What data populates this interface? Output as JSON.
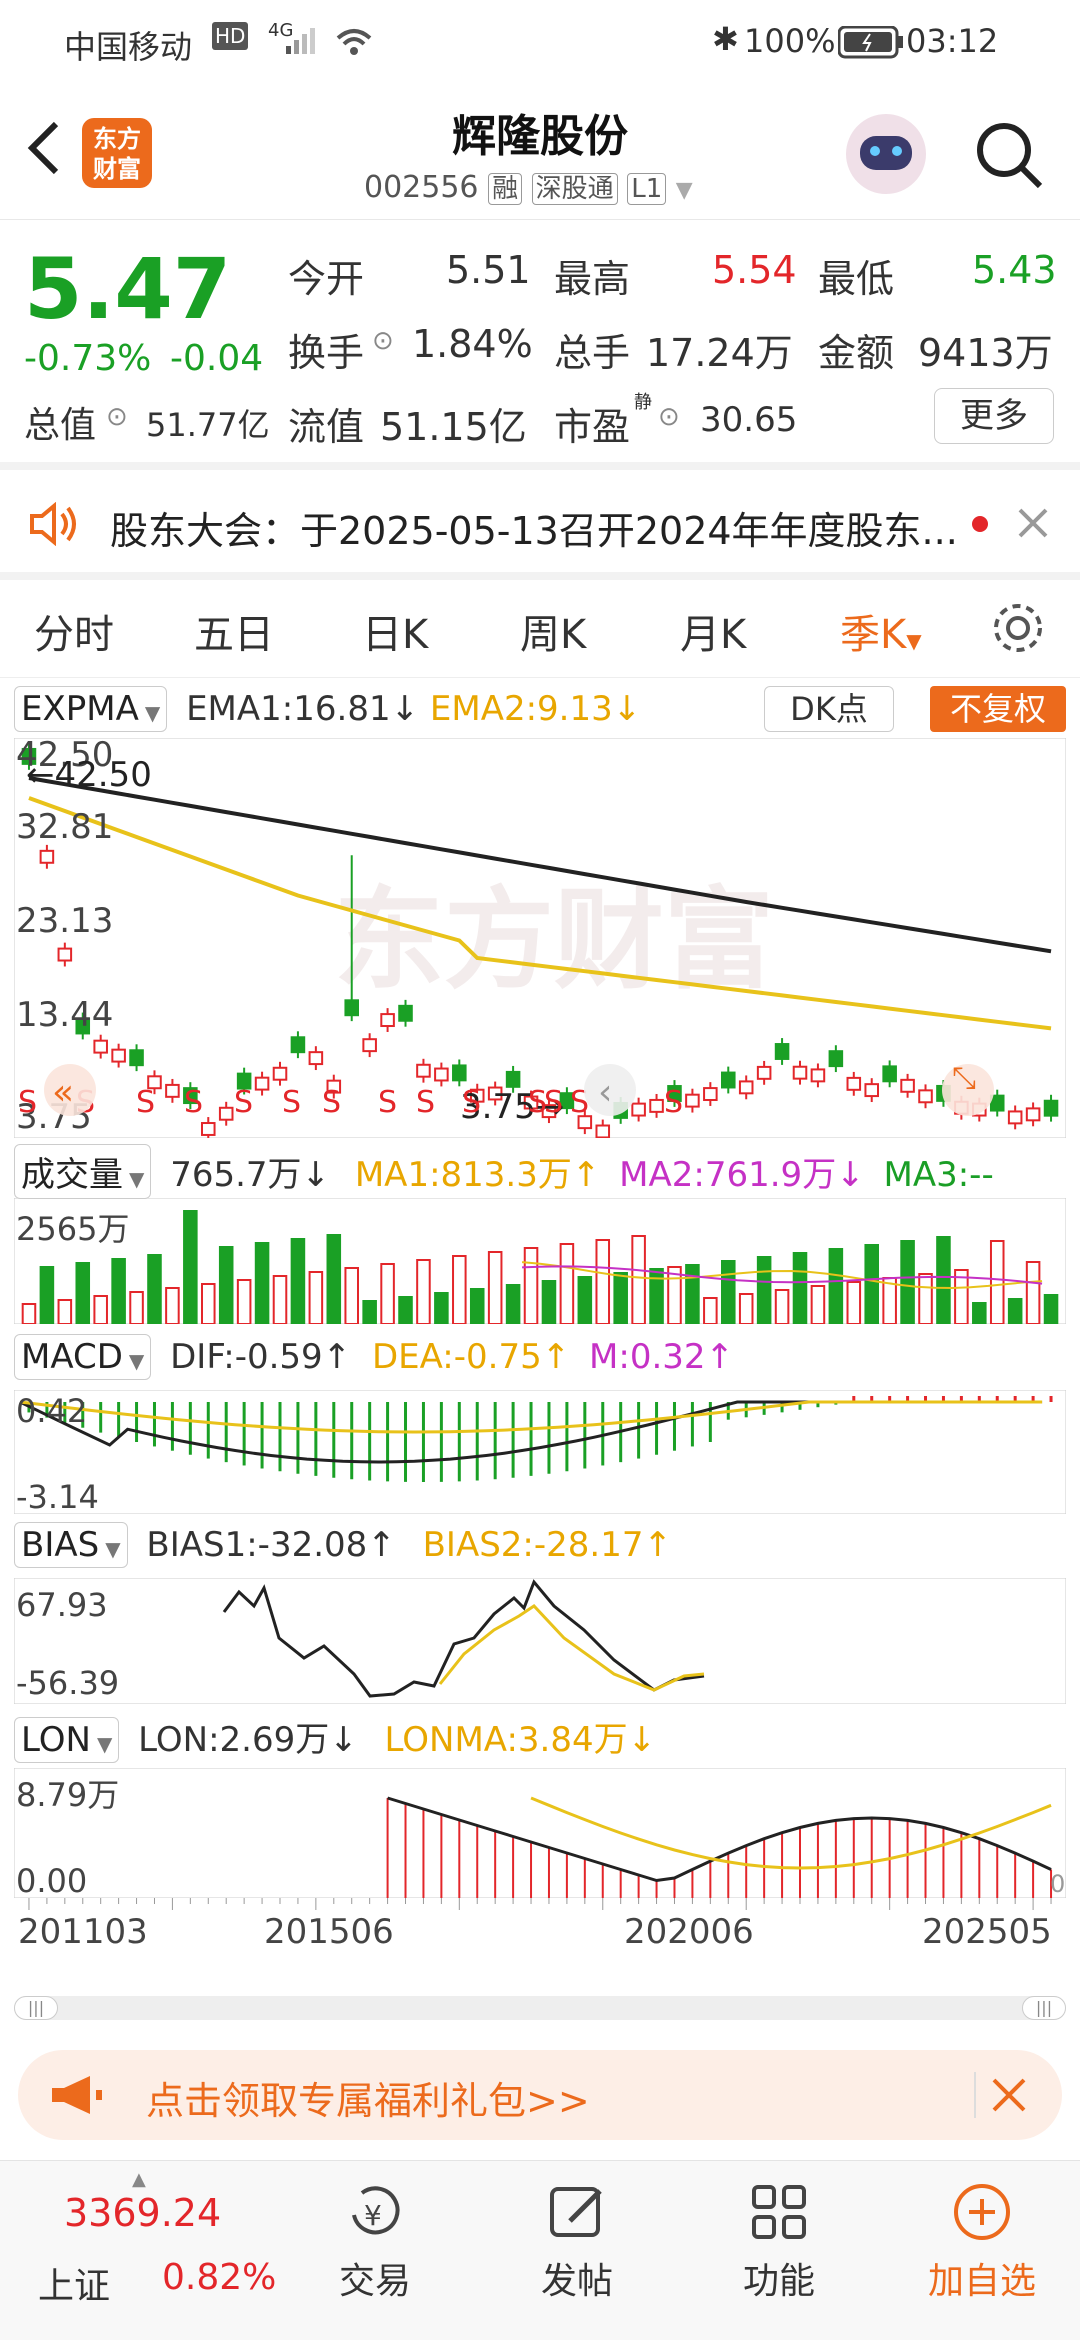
{
  "status_bar": {
    "carrier": "中国移动",
    "net_hd": "HD",
    "net_gen": "4G",
    "battery": "100%",
    "time": "03:12"
  },
  "header": {
    "title": "辉隆股份",
    "code": "002556",
    "badges": [
      "融",
      "深股通",
      "L1"
    ],
    "logo_text": "东方\n财富"
  },
  "quote": {
    "price": "5.47",
    "change_pct": "-0.73%",
    "change": "-0.04",
    "open_label": "今开",
    "open": "5.51",
    "high_label": "最高",
    "high": "5.54",
    "low_label": "最低",
    "low": "5.43",
    "turnover_label": "换手",
    "turnover": "1.84%",
    "volume_label": "总手",
    "volume": "17.24万",
    "amount_label": "金额",
    "amount": "9413万",
    "mktcap_label": "总值",
    "mktcap": "51.77亿",
    "float_label": "流值",
    "float_cap": "51.15亿",
    "pe_label": "市盈",
    "pe_sup": "静",
    "pe": "30.65",
    "more": "更多"
  },
  "notice": {
    "text": "股东大会：于2025-05-13召开2024年年度股东..."
  },
  "tabs": {
    "items": [
      "分时",
      "五日",
      "日K",
      "周K",
      "月K",
      "季K"
    ]
  },
  "main_chart": {
    "indicator": "EXPMA",
    "ema1": "EMA1:16.81↓",
    "ema2": "EMA2:9.13↓",
    "dk": "DK点",
    "fq": "不复权",
    "y_labels": [
      "42.50",
      "32.81",
      "23.13",
      "13.44",
      "3.75"
    ],
    "max_label": "←42.50",
    "min_label": "3.75→",
    "s_marks": [
      "S",
      "S",
      "S",
      "S",
      "S",
      "S",
      "S",
      "S",
      "S",
      "S",
      "S",
      "S",
      "S",
      "S"
    ]
  },
  "volume": {
    "indicator": "成交量",
    "value": "765.7万↓",
    "ma1": "MA1:813.3万↑",
    "ma2": "MA2:761.9万↓",
    "ma3": "MA3:--",
    "y_label": "2565万"
  },
  "macd": {
    "indicator": "MACD",
    "dif": "DIF:-0.59↑",
    "dea": "DEA:-0.75↑",
    "m": "M:0.32↑",
    "y_top": "0.42",
    "y_bot": "-3.14"
  },
  "bias": {
    "indicator": "BIAS",
    "b1": "BIAS1:-32.08↑",
    "b2": "BIAS2:-28.17↑",
    "y_top": "67.93",
    "y_bot": "-56.39"
  },
  "lon": {
    "indicator": "LON",
    "lon": "LON:2.69万↓",
    "lonma": "LONMA:3.84万↓",
    "y_top": "8.79万",
    "y_bot": "0.00",
    "right_zero": "0"
  },
  "x_axis": {
    "labels": [
      "201103",
      "201506",
      "202006",
      "202505"
    ]
  },
  "promo": {
    "text": "点击领取专属福利礼包>>"
  },
  "bottom_nav": {
    "index_value": "3369.24",
    "index_name": "上证",
    "index_change": "0.82%",
    "items": [
      "交易",
      "发帖",
      "功能",
      "加自选"
    ]
  },
  "colors": {
    "up": "#e3262a",
    "down": "#1aa025",
    "ema2": "#e8c21a",
    "accent": "#ec6a1c"
  }
}
